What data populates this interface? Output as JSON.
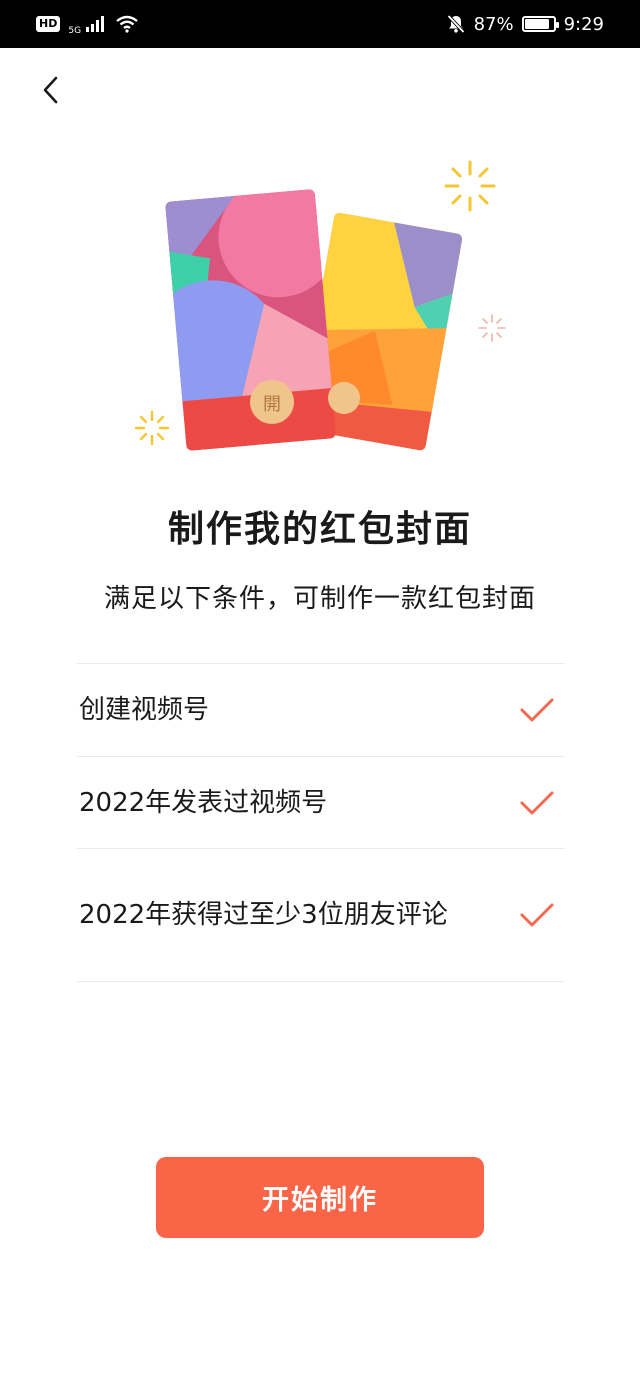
{
  "status_bar": {
    "hd": "HD",
    "network": "5G",
    "battery": "87%",
    "battery_level": 0.87,
    "time": "9:29"
  },
  "icons": {
    "back": "back-chevron-icon",
    "check": "check-icon",
    "signal": "signal-icon",
    "wifi": "wifi-icon",
    "mute": "bell-mute-icon",
    "battery": "battery-icon"
  },
  "illustration": {
    "coin_text": "開"
  },
  "title": "制作我的红包封面",
  "subtitle": "满足以下条件，可制作一款红包封面",
  "conditions": [
    {
      "label": "创建视频号",
      "met": true
    },
    {
      "label": "2022年发表过视频号",
      "met": true
    },
    {
      "label": "2022年获得过至少3位朋友评论",
      "met": true
    }
  ],
  "start_button": "开始制作",
  "colors": {
    "accent": "#fb6547",
    "check": "#f06a51"
  }
}
